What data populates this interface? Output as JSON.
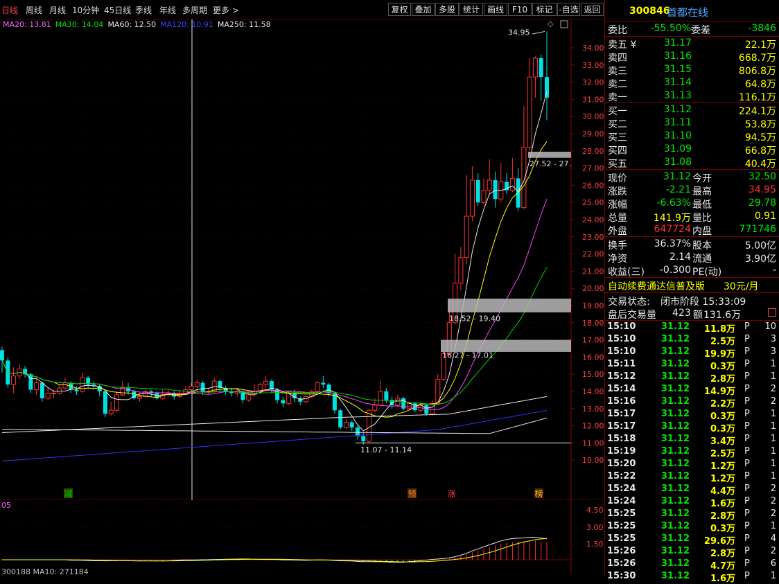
{
  "periods": [
    {
      "label": "日线",
      "active": true
    },
    {
      "label": "周线",
      "active": false
    },
    {
      "label": "月线",
      "active": false
    },
    {
      "label": "10分钟",
      "active": false
    },
    {
      "label": "45日线",
      "active": false
    },
    {
      "label": "季线",
      "active": false
    },
    {
      "label": "年线",
      "active": false
    },
    {
      "label": "多周期",
      "active": false
    },
    {
      "label": "更多 >",
      "active": false
    }
  ],
  "toolbar_buttons": [
    "复权",
    "叠加",
    "多股",
    "统计",
    "画线",
    "F10",
    "标记",
    "-自选",
    "返回"
  ],
  "ma_legend": [
    {
      "label": "MA20: 13.81",
      "color": "#ff66ff"
    },
    {
      "label": "MA30: 14.04",
      "color": "#00e000"
    },
    {
      "label": "MA60: 12.50",
      "color": "#e8e8e8"
    },
    {
      "label": "MA120: 10.91",
      "color": "#4040ff"
    },
    {
      "label": "MA250: 11.58",
      "color": "#e8e8e8"
    }
  ],
  "price_axis": [
    "34.00",
    "33.00",
    "32.00",
    "31.00",
    "30.00",
    "29.00",
    "28.00",
    "27.00",
    "26.00",
    "25.00",
    "24.00",
    "23.00",
    "22.00",
    "21.00",
    "20.00",
    "19.00",
    "18.00",
    "17.00",
    "16.00",
    "15.00",
    "14.00",
    "13.00",
    "12.00",
    "11.00",
    "10.00"
  ],
  "annotations": {
    "high": "34.95",
    "low_range": "11.07 - 11.14",
    "box1": "18.52 - 19.40",
    "box2": "16.27 - 17.01",
    "box3": "27.52 - 27."
  },
  "event_markers": [
    {
      "label": "减",
      "color": "#00c000",
      "bg": "#2a4a00"
    },
    {
      "label": "预",
      "color": "#ff8030",
      "bg": "#4a2a00"
    },
    {
      "label": "涨",
      "color": "#ff4040",
      "bg": "#000"
    },
    {
      "label": "榜",
      "color": "#ffb030",
      "bg": "#4a2a00"
    }
  ],
  "indicator": {
    "left_label": "05",
    "axis": [
      "4.50",
      "3.00",
      "1.50"
    ],
    "bottom_legend": "300188   MA10: 271184"
  },
  "stock": {
    "code": "300846",
    "name": "首都在线"
  },
  "weibi": {
    "label": "委比",
    "value": "-55.50%",
    "label2": "委差",
    "value2": "-3846"
  },
  "sell": [
    {
      "label": "卖五",
      "suffix": "¥",
      "price": "31.17",
      "vol": "22.1万"
    },
    {
      "label": "卖四",
      "suffix": "",
      "price": "31.16",
      "vol": "668.7万"
    },
    {
      "label": "卖三",
      "suffix": "",
      "price": "31.15",
      "vol": "806.8万"
    },
    {
      "label": "卖二",
      "suffix": "",
      "price": "31.14",
      "vol": "64.8万"
    },
    {
      "label": "卖一",
      "suffix": "",
      "price": "31.13",
      "vol": "116.1万"
    }
  ],
  "buy": [
    {
      "label": "买一",
      "price": "31.12",
      "vol": "224.1万"
    },
    {
      "label": "买二",
      "price": "31.11",
      "vol": "53.8万"
    },
    {
      "label": "买三",
      "price": "31.10",
      "vol": "94.5万"
    },
    {
      "label": "买四",
      "price": "31.09",
      "vol": "66.8万"
    },
    {
      "label": "买五",
      "price": "31.08",
      "vol": "40.4万"
    }
  ],
  "quote": [
    {
      "l1": "现价",
      "v1": "31.12",
      "c1": "green",
      "l2": "今开",
      "v2": "32.50",
      "c2": "green"
    },
    {
      "l1": "涨跌",
      "v1": "-2.21",
      "c1": "green",
      "l2": "最高",
      "v2": "34.95",
      "c2": "red"
    },
    {
      "l1": "涨幅",
      "v1": "-6.63%",
      "c1": "green",
      "l2": "最低",
      "v2": "29.78",
      "c2": "green"
    },
    {
      "l1": "总量",
      "v1": "141.9万",
      "c1": "yellow",
      "l2": "量比",
      "v2": "0.91",
      "c2": "yellow"
    },
    {
      "l1": "外盘",
      "v1": "647724",
      "c1": "red",
      "l2": "内盘",
      "v2": "771746",
      "c2": "green"
    }
  ],
  "fund": [
    {
      "l1": "换手",
      "v1": "36.37%",
      "l2": "股本",
      "v2": "5.00亿"
    },
    {
      "l1": "净资",
      "v1": "2.14",
      "l2": "流通",
      "v2": "3.90亿"
    },
    {
      "l1": "收益(三)",
      "v1": "-0.300",
      "l2": "PE(动)",
      "v2": "-"
    }
  ],
  "promo": {
    "text": "自动续费通达信普及版",
    "price": "30元/月"
  },
  "trade_status": {
    "label": "交易状态:",
    "value": "闭市阶段 15:33:09"
  },
  "after_hours": {
    "label": "盘后交易量",
    "v1": "423",
    "label2": "额",
    "v2": "131.6万"
  },
  "ticks": [
    {
      "time": "15:10",
      "price": "31.12",
      "vol": "11.8万",
      "flag": "P",
      "n": "10"
    },
    {
      "time": "15:10",
      "price": "31.12",
      "vol": "2.5万",
      "flag": "P",
      "n": "3"
    },
    {
      "time": "15:10",
      "price": "31.12",
      "vol": "19.9万",
      "flag": "P",
      "n": "3"
    },
    {
      "time": "15:11",
      "price": "31.12",
      "vol": "0.3万",
      "flag": "P",
      "n": "1"
    },
    {
      "time": "15:12",
      "price": "31.12",
      "vol": "2.8万",
      "flag": "P",
      "n": "1"
    },
    {
      "time": "15:14",
      "price": "31.12",
      "vol": "14.9万",
      "flag": "P",
      "n": "2"
    },
    {
      "time": "15:16",
      "price": "31.12",
      "vol": "2.2万",
      "flag": "P",
      "n": "2"
    },
    {
      "time": "15:17",
      "price": "31.12",
      "vol": "0.3万",
      "flag": "P",
      "n": "1"
    },
    {
      "time": "15:17",
      "price": "31.12",
      "vol": "0.3万",
      "flag": "P",
      "n": "1"
    },
    {
      "time": "15:18",
      "price": "31.12",
      "vol": "3.4万",
      "flag": "P",
      "n": "1"
    },
    {
      "time": "15:19",
      "price": "31.12",
      "vol": "2.5万",
      "flag": "P",
      "n": "1"
    },
    {
      "time": "15:20",
      "price": "31.12",
      "vol": "1.2万",
      "flag": "P",
      "n": "1"
    },
    {
      "time": "15:22",
      "price": "31.12",
      "vol": "1.2万",
      "flag": "P",
      "n": "1"
    },
    {
      "time": "15:24",
      "price": "31.12",
      "vol": "4.4万",
      "flag": "P",
      "n": "2"
    },
    {
      "time": "15:24",
      "price": "31.12",
      "vol": "1.6万",
      "flag": "P",
      "n": "2"
    },
    {
      "time": "15:25",
      "price": "31.12",
      "vol": "2.8万",
      "flag": "P",
      "n": "2"
    },
    {
      "time": "15:25",
      "price": "31.12",
      "vol": "0.3万",
      "flag": "P",
      "n": "1"
    },
    {
      "time": "15:25",
      "price": "31.12",
      "vol": "29.6万",
      "flag": "P",
      "n": "4"
    },
    {
      "time": "15:26",
      "price": "31.12",
      "vol": "2.8万",
      "flag": "P",
      "n": "2"
    },
    {
      "time": "15:26",
      "price": "31.12",
      "vol": "4.7万",
      "flag": "P",
      "n": "6"
    },
    {
      "time": "15:30",
      "price": "31.12",
      "vol": "1.6万",
      "flag": "P",
      "n": "1"
    }
  ],
  "chart_data": {
    "type": "candlestick",
    "up_color": "#ff3030",
    "down_color": "#00e0e0",
    "candles": [
      [
        16.4,
        15.8,
        16.6,
        15.1
      ],
      [
        15.8,
        14.4,
        16.0,
        14.2
      ],
      [
        14.4,
        14.9,
        15.4,
        13.9
      ],
      [
        14.9,
        15.3,
        15.6,
        14.7
      ],
      [
        15.3,
        15.0,
        15.5,
        14.8
      ],
      [
        15.0,
        14.1,
        15.1,
        13.9
      ],
      [
        14.1,
        14.5,
        14.7,
        13.8
      ],
      [
        14.5,
        13.6,
        14.6,
        13.4
      ],
      [
        13.6,
        13.9,
        14.2,
        13.5
      ],
      [
        13.9,
        13.9,
        14.1,
        13.6
      ],
      [
        13.9,
        14.2,
        14.4,
        13.8
      ],
      [
        14.2,
        14.5,
        14.8,
        14.1
      ],
      [
        14.5,
        14.1,
        14.6,
        13.9
      ],
      [
        14.1,
        14.0,
        14.3,
        13.8
      ],
      [
        14.0,
        14.8,
        15.1,
        13.9
      ],
      [
        14.8,
        14.4,
        14.9,
        14.2
      ],
      [
        14.4,
        14.3,
        14.6,
        14.1
      ],
      [
        14.3,
        14.0,
        14.4,
        13.7
      ],
      [
        14.0,
        12.7,
        14.1,
        12.5
      ],
      [
        12.7,
        12.9,
        13.4,
        12.6
      ],
      [
        12.9,
        13.8,
        14.0,
        12.8
      ],
      [
        13.8,
        14.2,
        14.6,
        13.7
      ],
      [
        14.2,
        14.0,
        14.5,
        13.8
      ],
      [
        14.0,
        13.6,
        14.1,
        13.5
      ],
      [
        13.6,
        13.7,
        13.9,
        13.4
      ],
      [
        13.7,
        14.0,
        14.2,
        13.6
      ],
      [
        14.0,
        13.9,
        14.1,
        13.7
      ],
      [
        13.9,
        13.6,
        14.0,
        13.5
      ],
      [
        13.6,
        13.8,
        14.1,
        13.5
      ],
      [
        13.8,
        13.9,
        14.1,
        13.7
      ],
      [
        13.9,
        13.7,
        14.0,
        13.5
      ],
      [
        13.7,
        13.9,
        14.1,
        13.6
      ],
      [
        13.9,
        14.1,
        14.3,
        13.8
      ],
      [
        14.1,
        14.3,
        14.5,
        13.9
      ],
      [
        14.3,
        14.5,
        14.7,
        14.0
      ],
      [
        14.5,
        14.0,
        14.6,
        13.8
      ],
      [
        14.0,
        14.0,
        14.2,
        13.8
      ],
      [
        14.0,
        14.6,
        14.8,
        13.9
      ],
      [
        14.6,
        14.2,
        14.7,
        14.0
      ],
      [
        14.2,
        14.0,
        14.3,
        13.8
      ],
      [
        14.0,
        13.9,
        14.2,
        13.7
      ],
      [
        13.9,
        14.0,
        14.2,
        13.7
      ],
      [
        14.0,
        13.5,
        14.1,
        13.3
      ],
      [
        13.5,
        13.8,
        14.0,
        13.4
      ],
      [
        13.8,
        14.0,
        14.4,
        13.7
      ],
      [
        14.0,
        14.4,
        14.5,
        13.9
      ],
      [
        14.4,
        14.6,
        14.9,
        14.2
      ],
      [
        14.6,
        14.1,
        14.7,
        13.9
      ],
      [
        14.1,
        13.5,
        14.2,
        13.3
      ],
      [
        13.5,
        13.3,
        13.7,
        13.1
      ],
      [
        13.3,
        13.9,
        14.0,
        13.2
      ],
      [
        13.9,
        13.6,
        14.1,
        13.4
      ],
      [
        13.6,
        13.4,
        13.7,
        13.2
      ],
      [
        13.4,
        13.7,
        13.8,
        13.3
      ],
      [
        13.7,
        14.0,
        14.1,
        13.6
      ],
      [
        14.0,
        14.5,
        14.6,
        13.9
      ],
      [
        14.5,
        14.4,
        14.9,
        14.2
      ],
      [
        14.4,
        13.9,
        14.5,
        13.7
      ],
      [
        13.9,
        12.9,
        14.0,
        12.7
      ],
      [
        12.9,
        11.9,
        13.0,
        11.8
      ],
      [
        11.9,
        12.2,
        12.4,
        11.8
      ],
      [
        12.2,
        11.9,
        12.3,
        11.7
      ],
      [
        11.9,
        11.4,
        12.0,
        11.2
      ],
      [
        11.4,
        11.1,
        11.6,
        10.9
      ],
      [
        11.1,
        12.9,
        13.0,
        11.0
      ],
      [
        12.9,
        13.2,
        13.6,
        12.8
      ],
      [
        13.2,
        14.0,
        14.6,
        13.1
      ],
      [
        14.0,
        13.5,
        14.2,
        13.3
      ],
      [
        13.5,
        13.2,
        13.7,
        13.0
      ],
      [
        13.2,
        13.6,
        13.8,
        13.1
      ],
      [
        13.6,
        13.0,
        13.7,
        12.9
      ],
      [
        13.0,
        13.3,
        13.4,
        12.9
      ],
      [
        13.3,
        12.9,
        13.4,
        12.8
      ],
      [
        12.9,
        13.2,
        13.3,
        12.8
      ],
      [
        13.2,
        12.7,
        13.3,
        12.6
      ],
      [
        12.7,
        13.3,
        13.5,
        12.6
      ],
      [
        13.3,
        14.7,
        15.0,
        13.2
      ],
      [
        14.7,
        16.2,
        16.4,
        14.6
      ],
      [
        16.2,
        18.0,
        19.4,
        16.1
      ],
      [
        18.0,
        20.3,
        22.0,
        17.9
      ],
      [
        20.3,
        21.8,
        22.4,
        19.9
      ],
      [
        21.8,
        24.2,
        26.6,
        21.4
      ],
      [
        24.2,
        26.3,
        27.1,
        23.9
      ],
      [
        26.3,
        25.0,
        26.7,
        24.8
      ],
      [
        25.0,
        25.7,
        26.4,
        24.9
      ],
      [
        25.7,
        26.3,
        27.5,
        25.4
      ],
      [
        26.3,
        25.2,
        26.8,
        24.7
      ],
      [
        25.2,
        26.2,
        27.3,
        25.0
      ],
      [
        26.2,
        25.7,
        26.7,
        25.5
      ],
      [
        25.7,
        26.4,
        27.6,
        25.6
      ],
      [
        26.4,
        24.7,
        27.0,
        24.5
      ],
      [
        24.7,
        28.2,
        30.6,
        24.6
      ],
      [
        28.2,
        32.3,
        33.4,
        28.0
      ],
      [
        32.3,
        33.4,
        33.5,
        31.1
      ],
      [
        33.4,
        32.3,
        33.6,
        30.9
      ],
      [
        32.3,
        31.1,
        34.95,
        29.78
      ]
    ]
  }
}
